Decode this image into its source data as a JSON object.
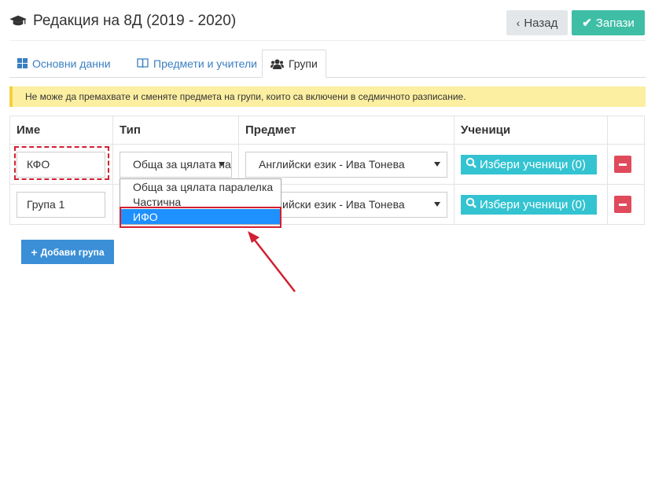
{
  "header": {
    "icon": "graduation-cap-icon",
    "title": "Редакция на 8Д (2019 - 2020)",
    "back_label": "Назад",
    "save_label": "Запази"
  },
  "tabs": [
    {
      "label": "Основни данни",
      "icon": "grid-icon",
      "active": false
    },
    {
      "label": "Предмети и учители",
      "icon": "book-icon",
      "active": false
    },
    {
      "label": "Групи",
      "icon": "users-icon",
      "active": true
    }
  ],
  "alert": {
    "text": "Не може да премахвате и сменяте предмета на групи, които са включени в седмичното разписание."
  },
  "table": {
    "headers": [
      "Име",
      "Тип",
      "Предмет",
      "Ученици",
      ""
    ],
    "rows": [
      {
        "name": "КФО",
        "type": "Обща за цялата паралелка",
        "subject": "Английски език - Ива Тонева",
        "students_label": "Избери ученици (0)"
      },
      {
        "name": "Група 1",
        "type": "Обща за цялата паралелка",
        "subject": "Английски език - Ива Тонева",
        "students_label": "Избери ученици (0)"
      }
    ]
  },
  "dropdown": {
    "options": [
      "Обща за цялата паралелка",
      "Частична",
      "ИФО"
    ],
    "selected": "ИФО"
  },
  "add_group_label": "Добави група",
  "colors": {
    "save": "#3fbea6",
    "students": "#33c3d1",
    "delete": "#e04b5b",
    "add": "#3a8fd6",
    "alert_bg": "#fcefa1",
    "highlight": "#d1202f"
  }
}
